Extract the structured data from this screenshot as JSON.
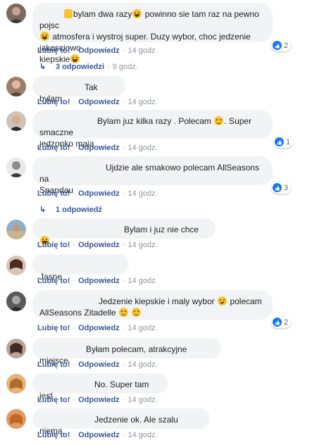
{
  "labels": {
    "like": "Lubię to!",
    "reply": "Odpowiedz",
    "dot": "·"
  },
  "comments": [
    {
      "text1": "bylam dwa razy",
      "text2": "powinno sie tam raz na pewno pojsc",
      "text3": "atmosfera i wystroj super. Duzy wybor, choc jedzenie jakosciowo",
      "text4": "kiepskie",
      "time": "14 godz.",
      "reactions": "2"
    },
    {
      "text": "Tak bylam",
      "time": "14 godz."
    },
    {
      "text1": "Bylam juz kilka razy . Polecam",
      "text2": ". Super smaczne",
      "text3": "jedzonko maja",
      "time": "14 godz.",
      "reactions": "1"
    },
    {
      "text1": "Ujdzie ale smakowo polecam AllSeasons na",
      "text2": "Spandau",
      "time": "14 godz.",
      "reactions": "3"
    },
    {
      "text": "Bylam i juz nie chce",
      "time": "14 godz."
    },
    {
      "text": "Jasne",
      "time": "14 godz."
    },
    {
      "text1": "Jedzenie kiepskie i maly wybor",
      "text2": "polecam",
      "text3": "AllSeasons Zitadelle",
      "time": "14 godz.",
      "reactions": "2"
    },
    {
      "text": "Byłam polecam, atrakcyjne miejsce",
      "time": "14 godz."
    },
    {
      "text": "No. Super tam jest",
      "time": "14 godz."
    },
    {
      "text": "Jedzenie ok. Ale szalu niema.",
      "time": "14 godz."
    }
  ],
  "replies": [
    {
      "label": "3 odpowiedzi",
      "time": "9 godz."
    },
    {
      "label": "1 odpowiedź"
    }
  ],
  "colors": {
    "bubble": "#f2f3f5",
    "link": "#385898",
    "meta": "#90949c",
    "like_blue": "#1877f2"
  }
}
